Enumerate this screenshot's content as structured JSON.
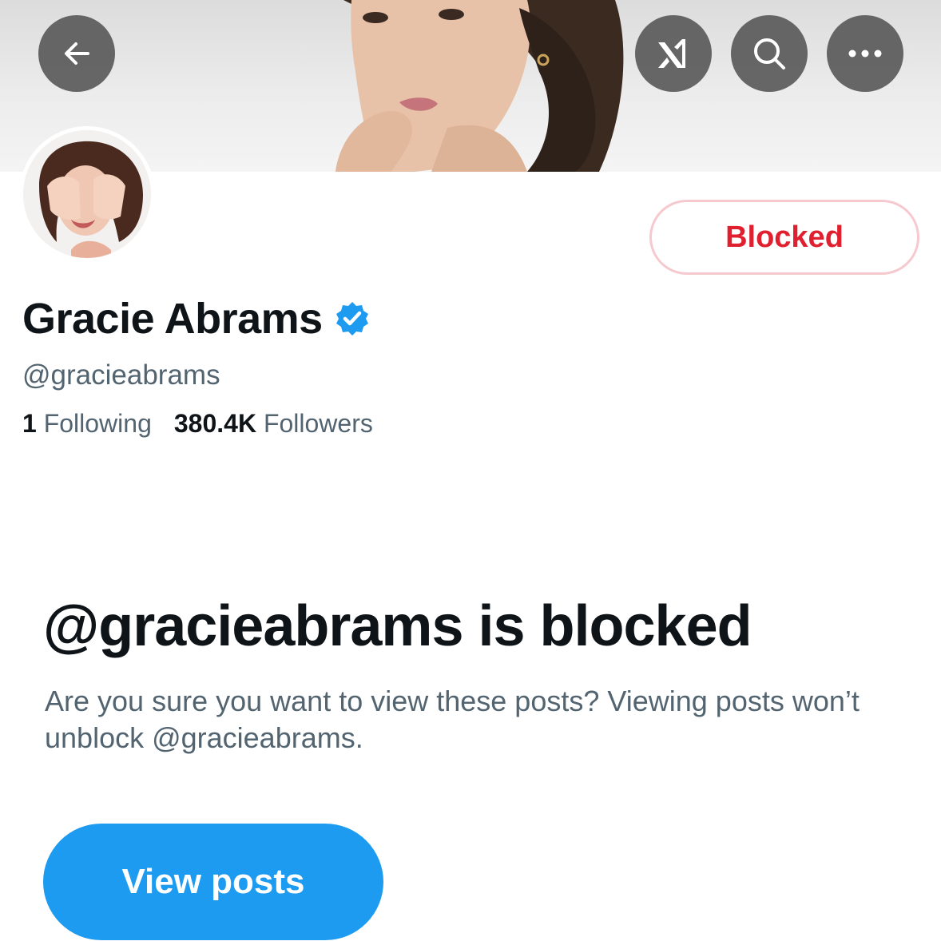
{
  "header": {
    "back_icon": "arrow-left-icon",
    "grok_icon": "grok-logo-icon",
    "search_icon": "search-icon",
    "more_icon": "more-horizontal-icon"
  },
  "profile": {
    "name": "Gracie Abrams",
    "handle": "@gracieabrams",
    "verified_icon": "verified-badge-icon",
    "following_count": "1",
    "following_label": "Following",
    "followers_count": "380.4K",
    "followers_label": "Followers",
    "blocked_button_label": "Blocked"
  },
  "blocked_notice": {
    "title": "@gracieabrams is blocked",
    "body": "Are you sure you want to view these posts? Viewing posts won’t unblock @gracieabrams.",
    "view_button_label": "View posts"
  },
  "colors": {
    "accent_blue": "#1d9bf0",
    "blocked_red": "#e0202f",
    "blocked_border": "#f6c9cf",
    "secondary_text": "#536471",
    "primary_text": "#0f1419"
  }
}
